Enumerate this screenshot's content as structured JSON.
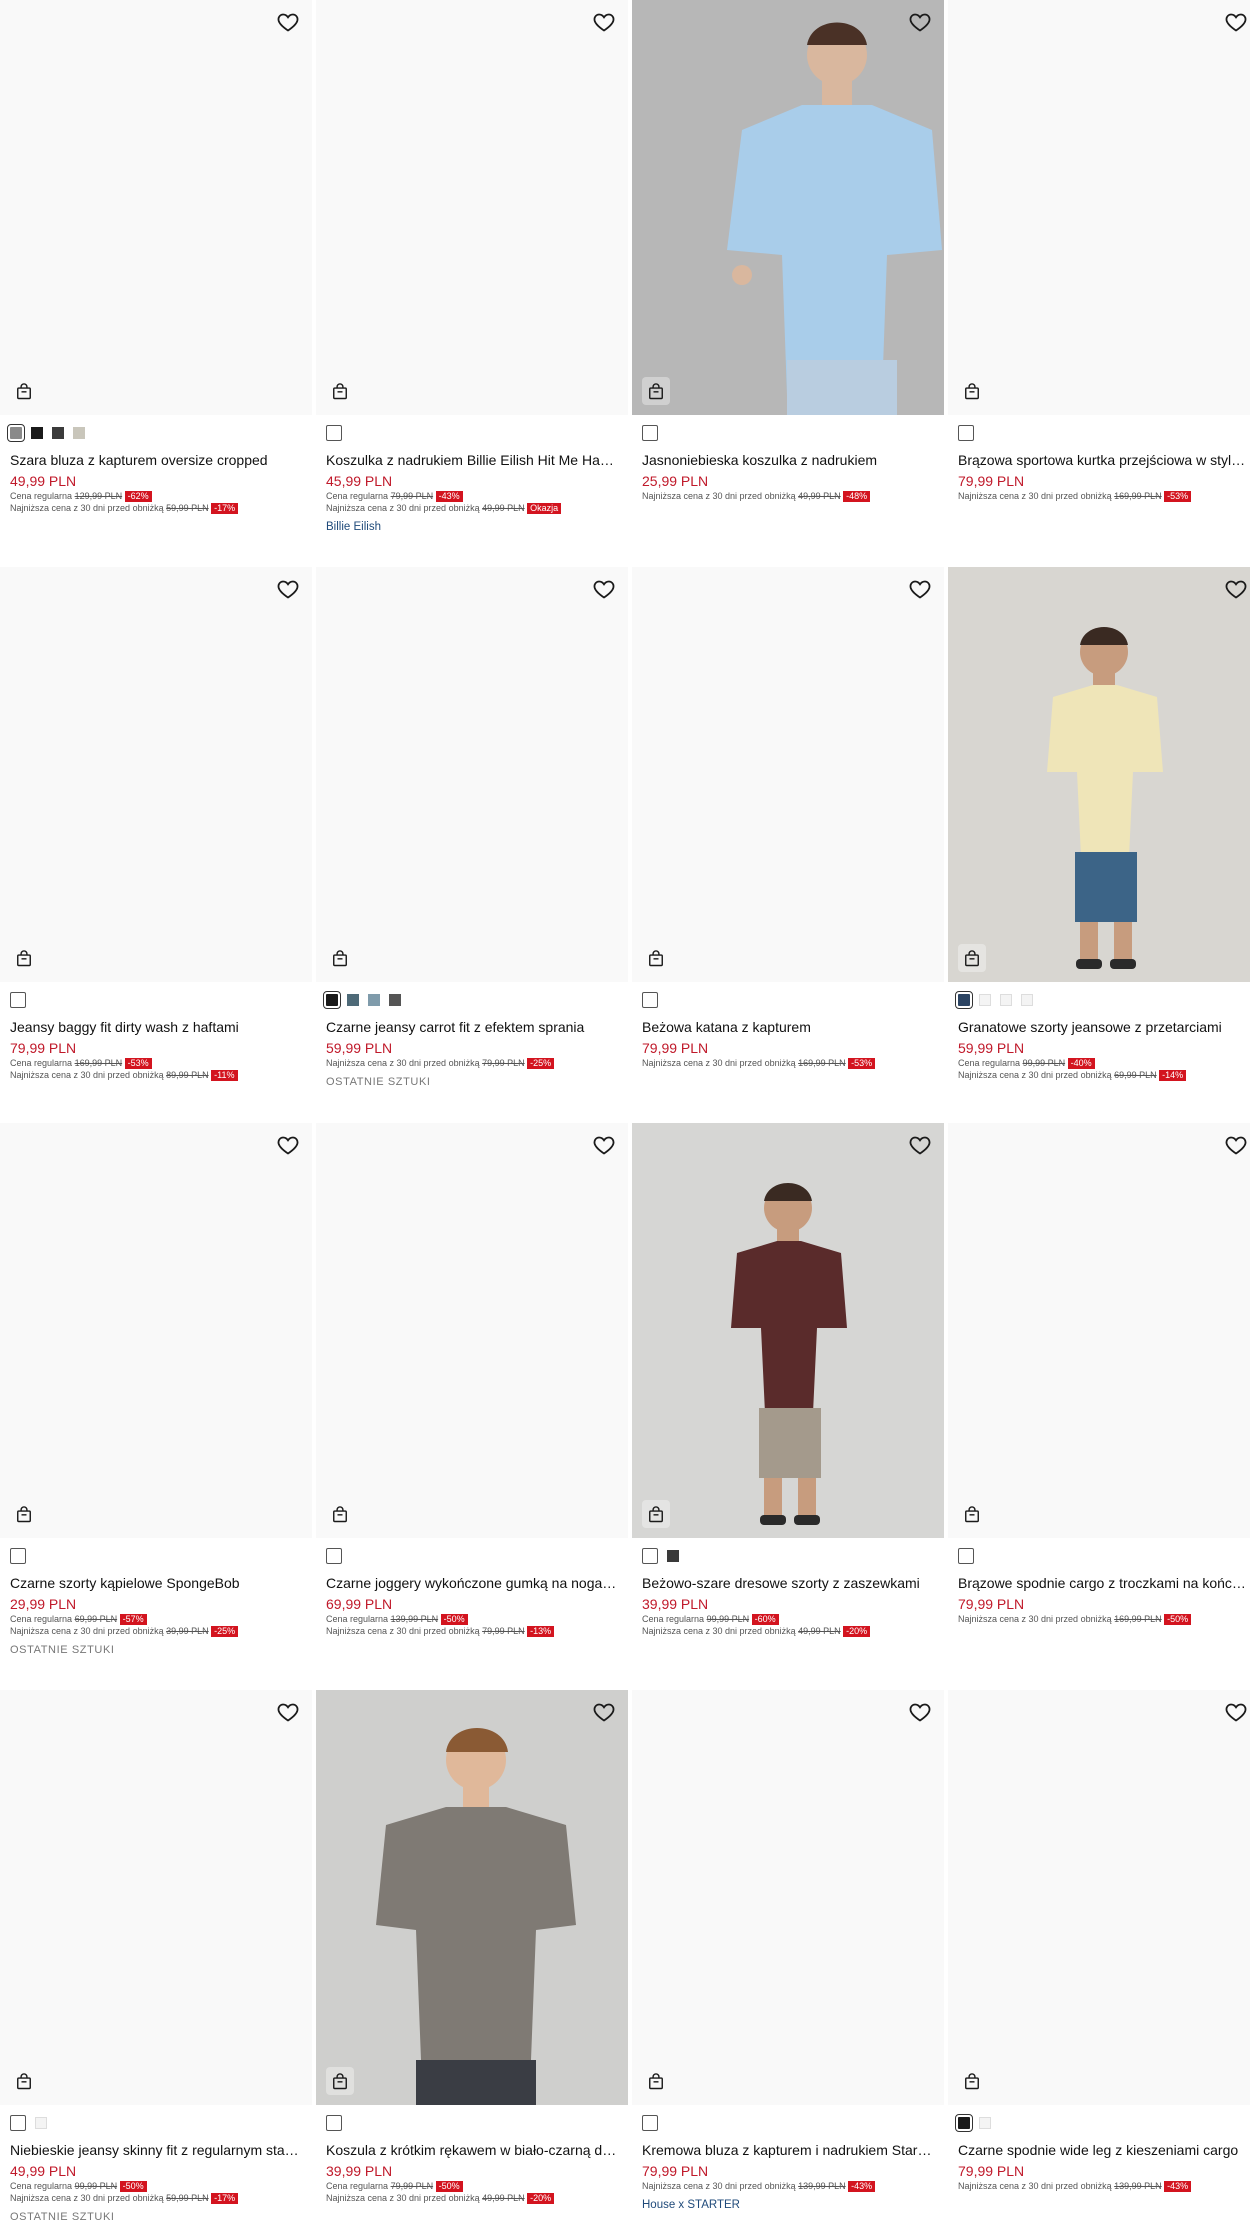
{
  "labels": {
    "regular": "Cena regularna",
    "lowest": "Najniższa cena z 30 dni przed obniżką"
  },
  "colors": {
    "price": "#c0192a",
    "discount_badge": "#d3141f",
    "brand_link": "#1f4a7a"
  },
  "icons": {
    "wishlist": "heart-icon",
    "add_to_cart": "shopping-bag-icon"
  },
  "products": [
    {
      "name": "Szara bluza z kapturem oversize cropped",
      "price": "49,99 PLN",
      "regular": "129,99 PLN",
      "regular_disc": "-62%",
      "lowest": "59,99 PLN",
      "lowest_disc": "-17%",
      "extra": "",
      "extra_type": "",
      "photo": false,
      "swatches": [
        "#8a8a8a",
        "#1a1a1a",
        "#3b3b3b",
        "#c9c6bb"
      ],
      "selected": 0
    },
    {
      "name": "Koszulka z nadrukiem Billie Eilish Hit Me Har…",
      "price": "45,99 PLN",
      "regular": "79,99 PLN",
      "regular_disc": "-43%",
      "lowest": "49,99 PLN",
      "lowest_disc": "Okazja",
      "extra": "Billie Eilish",
      "extra_type": "brand",
      "photo": false,
      "swatches": [],
      "selected": -1
    },
    {
      "name": "Jasnoniebieska koszulka z nadrukiem",
      "price": "25,99 PLN",
      "regular": "",
      "regular_disc": "",
      "lowest": "49,99 PLN",
      "lowest_disc": "-48%",
      "extra": "",
      "extra_type": "",
      "photo": true,
      "swatches": [],
      "selected": -1
    },
    {
      "name": "Brązowa sportowa kurtka przejściowa w styl…",
      "price": "79,99 PLN",
      "regular": "",
      "regular_disc": "",
      "lowest": "169,99 PLN",
      "lowest_disc": "-53%",
      "extra": "",
      "extra_type": "",
      "photo": false,
      "swatches": [],
      "selected": -1
    },
    {
      "name": "Jeansy baggy fit dirty wash z haftami",
      "price": "79,99 PLN",
      "regular": "169,99 PLN",
      "regular_disc": "-53%",
      "lowest": "89,99 PLN",
      "lowest_disc": "-11%",
      "extra": "",
      "extra_type": "",
      "photo": false,
      "swatches": [],
      "selected": -1
    },
    {
      "name": "Czarne jeansy carrot fit z efektem sprania",
      "price": "59,99 PLN",
      "regular": "",
      "regular_disc": "",
      "lowest": "79,99 PLN",
      "lowest_disc": "-25%",
      "extra": "OSTATNIE SZTUKI",
      "extra_type": "note",
      "photo": false,
      "swatches": [
        "#1a1a1a",
        "#4e6a78",
        "#7f9bab",
        "#555555"
      ],
      "selected": 0
    },
    {
      "name": "Beżowa katana z kapturem",
      "price": "79,99 PLN",
      "regular": "",
      "regular_disc": "",
      "lowest": "169,99 PLN",
      "lowest_disc": "-53%",
      "extra": "",
      "extra_type": "",
      "photo": false,
      "swatches": [],
      "selected": -1
    },
    {
      "name": "Granatowe szorty jeansowe z przetarciami",
      "price": "59,99 PLN",
      "regular": "99,99 PLN",
      "regular_disc": "-40%",
      "lowest": "69,99 PLN",
      "lowest_disc": "-14%",
      "extra": "",
      "extra_type": "",
      "photo": true,
      "swatches": [
        "#2c4463",
        "#f4f4f4",
        "#f4f4f4",
        "#f4f4f4"
      ],
      "selected": 0
    },
    {
      "name": "Czarne szorty kąpielowe SpongeBob",
      "price": "29,99 PLN",
      "regular": "69,99 PLN",
      "regular_disc": "-57%",
      "lowest": "39,99 PLN",
      "lowest_disc": "-25%",
      "extra": "OSTATNIE SZTUKI",
      "extra_type": "note",
      "photo": false,
      "swatches": [],
      "selected": -1
    },
    {
      "name": "Czarne joggery wykończone gumką na noga…",
      "price": "69,99 PLN",
      "regular": "139,99 PLN",
      "regular_disc": "-50%",
      "lowest": "79,99 PLN",
      "lowest_disc": "-13%",
      "extra": "",
      "extra_type": "",
      "photo": false,
      "swatches": [],
      "selected": -1
    },
    {
      "name": "Beżowo-szare dresowe szorty z zaszewkami",
      "price": "39,99 PLN",
      "regular": "99,99 PLN",
      "regular_disc": "-60%",
      "lowest": "49,99 PLN",
      "lowest_disc": "-20%",
      "extra": "",
      "extra_type": "",
      "photo": true,
      "swatches": [
        "#ffffff",
        "#3a3a3a"
      ],
      "selected": -1
    },
    {
      "name": "Brązowe spodnie cargo z troczkami na końc…",
      "price": "79,99 PLN",
      "regular": "",
      "regular_disc": "",
      "lowest": "169,99 PLN",
      "lowest_disc": "-50%",
      "extra": "",
      "extra_type": "",
      "photo": false,
      "swatches": [],
      "selected": -1
    },
    {
      "name": "Niebieskie jeansy skinny fit z regularnym sta…",
      "price": "49,99 PLN",
      "regular": "99,99 PLN",
      "regular_disc": "-50%",
      "lowest": "59,99 PLN",
      "lowest_disc": "-17%",
      "extra": "OSTATNIE SZTUKI",
      "extra_type": "note",
      "photo": false,
      "swatches": [
        "#ffffff",
        "#f4f4f4"
      ],
      "selected": -1
    },
    {
      "name": "Koszula z krótkim rękawem w biało-czarną d…",
      "price": "39,99 PLN",
      "regular": "79,99 PLN",
      "regular_disc": "-50%",
      "lowest": "49,99 PLN",
      "lowest_disc": "-20%",
      "extra": "",
      "extra_type": "",
      "photo": true,
      "swatches": [],
      "selected": -1
    },
    {
      "name": "Kremowa bluza z kapturem i nadrukiem Star…",
      "price": "79,99 PLN",
      "regular": "",
      "regular_disc": "",
      "lowest": "139,99 PLN",
      "lowest_disc": "-43%",
      "extra": "House x STARTER",
      "extra_type": "brand",
      "photo": false,
      "swatches": [],
      "selected": -1
    },
    {
      "name": "Czarne spodnie wide leg z kieszeniami cargo",
      "price": "79,99 PLN",
      "regular": "",
      "regular_disc": "",
      "lowest": "139,99 PLN",
      "lowest_disc": "-43%",
      "extra": "",
      "extra_type": "",
      "photo": false,
      "swatches": [
        "#1a1a1a",
        "#f4f4f4"
      ],
      "selected": 0
    }
  ]
}
